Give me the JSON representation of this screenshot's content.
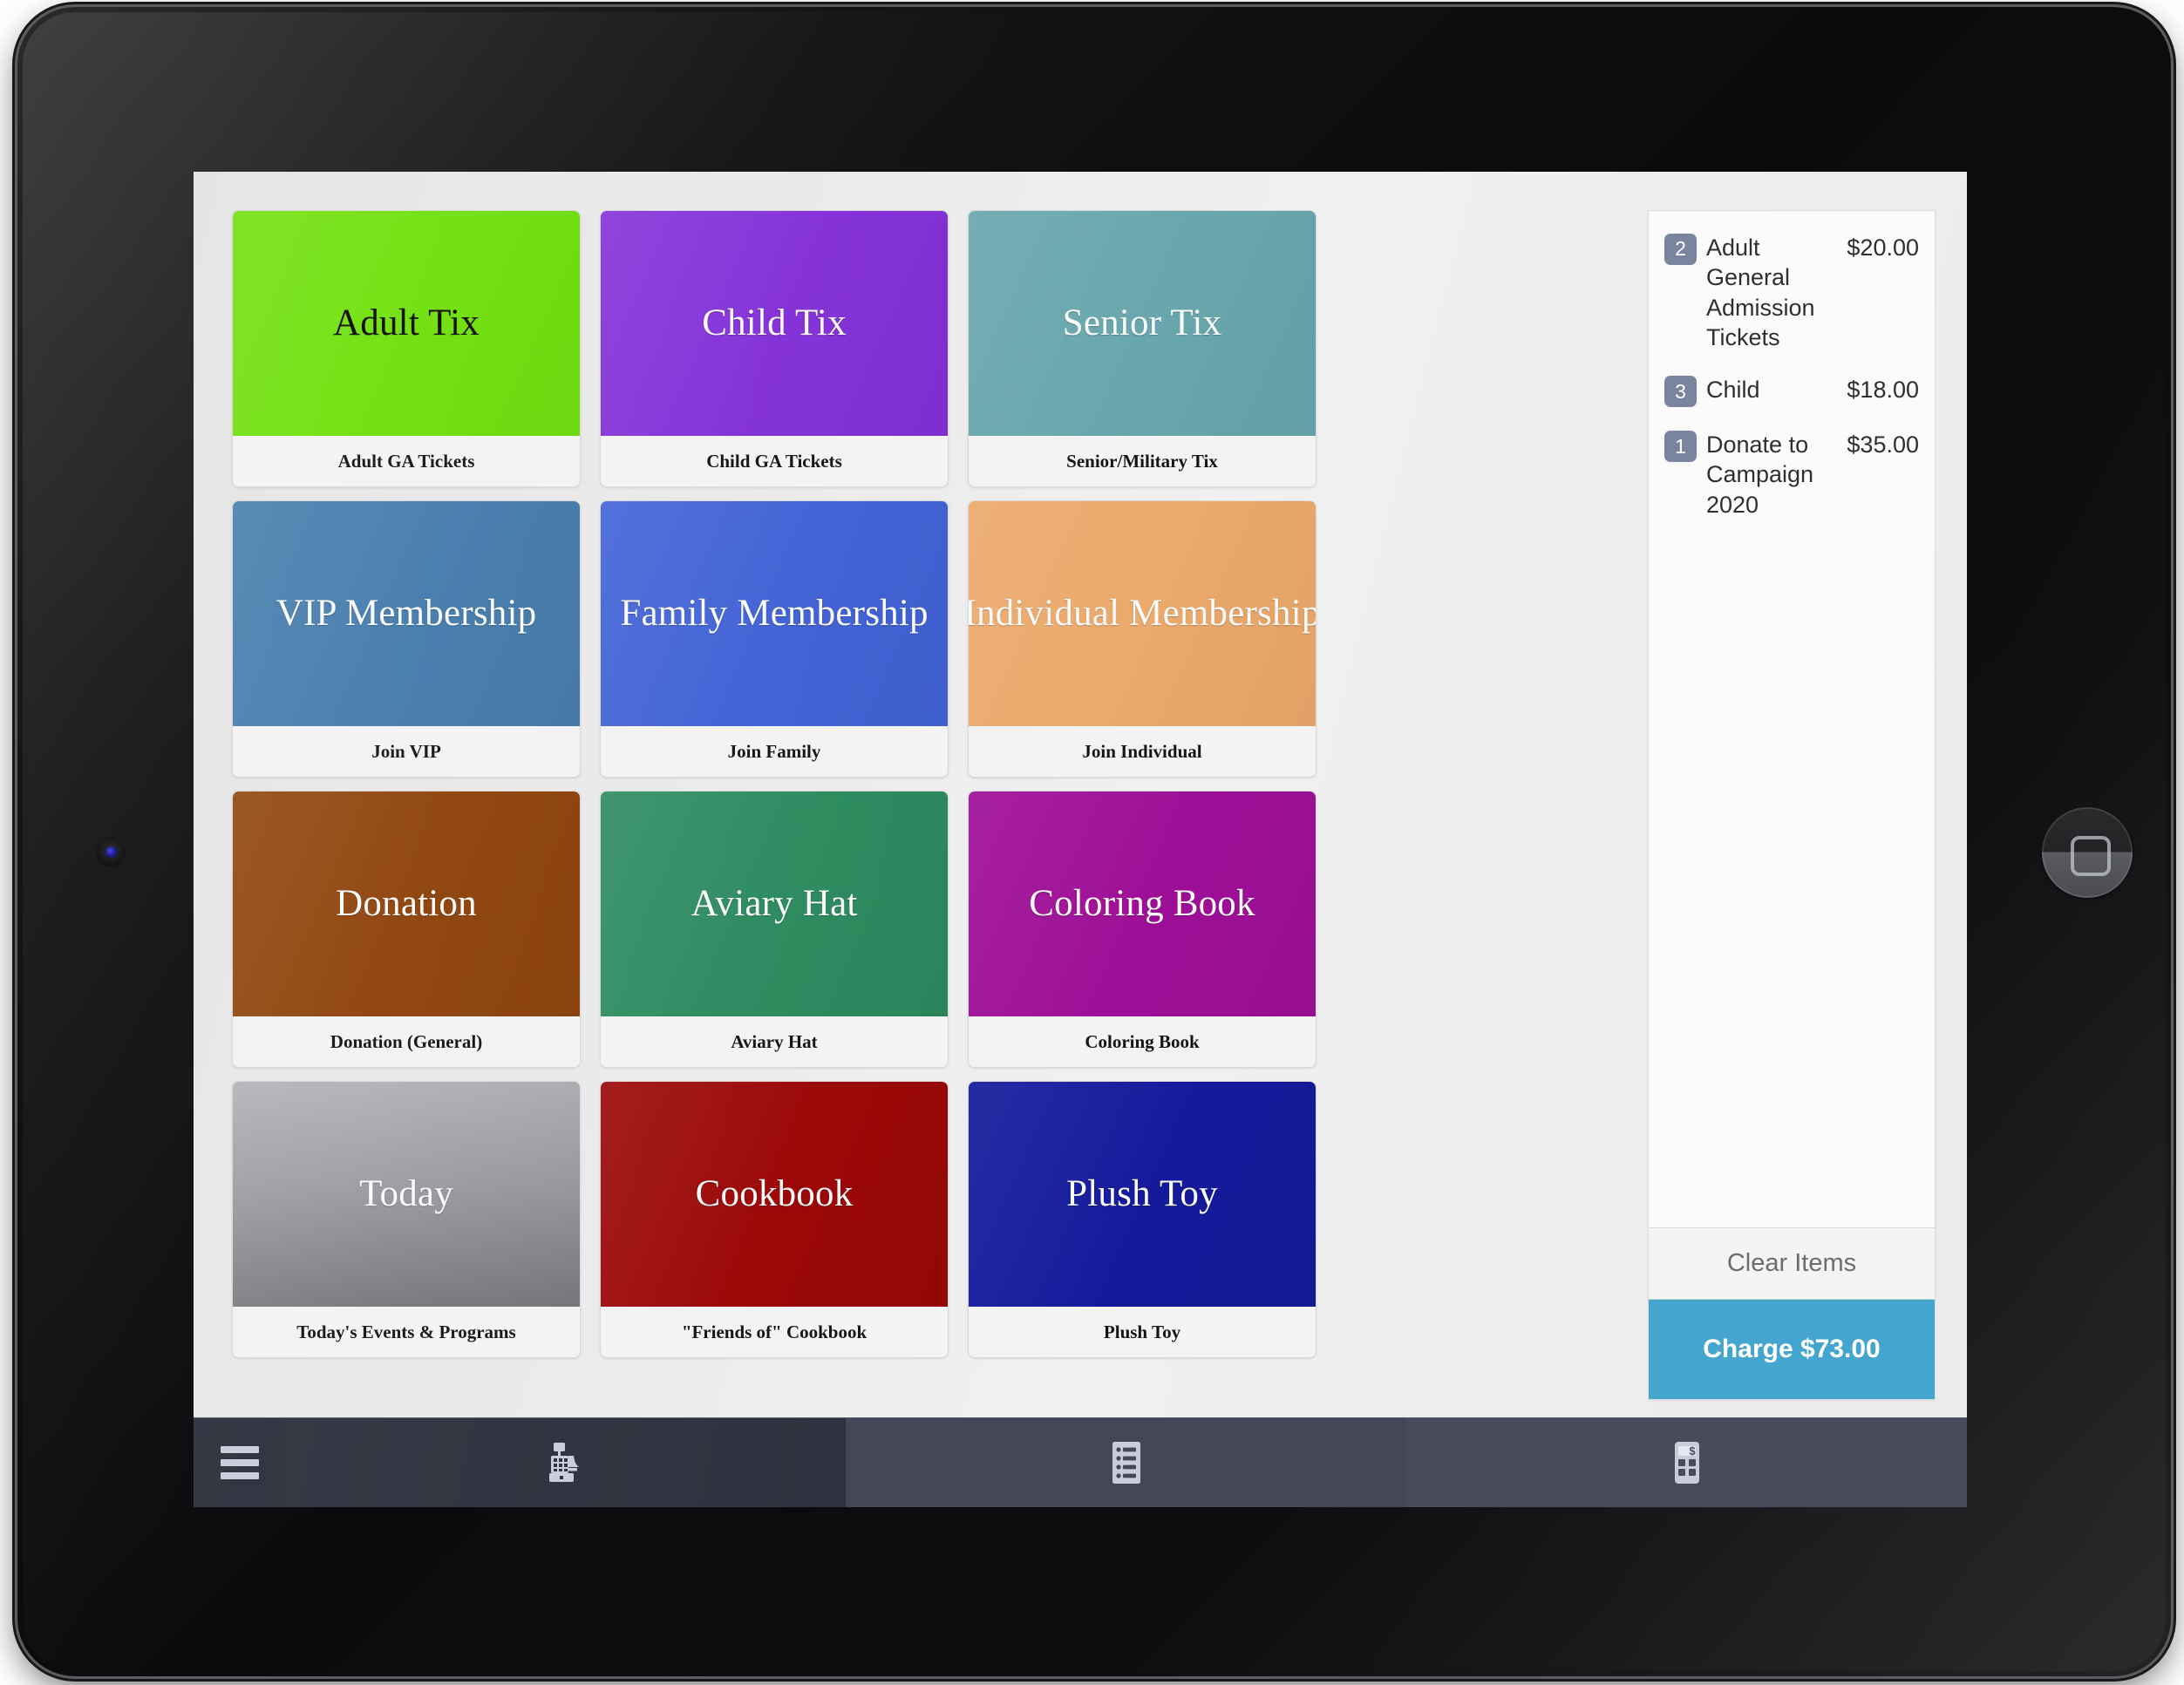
{
  "device": {
    "type": "tablet",
    "camera_icon": "front-camera",
    "home_button_icon": "home-button"
  },
  "grid": {
    "tiles": [
      {
        "title": "Adult Tix",
        "caption": "Adult GA Tickets",
        "color": "#6FE00A",
        "text": "dark"
      },
      {
        "title": "Child Tix",
        "caption": "Child GA Tickets",
        "color": "#8330D8",
        "text": "light"
      },
      {
        "title": "Senior Tix",
        "caption": "Senior/Military Tix",
        "color": "#68A7AD",
        "text": "light"
      },
      {
        "title": "VIP Membership",
        "caption": "Join VIP",
        "color": "#447BAC",
        "text": "light"
      },
      {
        "title": "Family Membership",
        "caption": "Join Family",
        "color": "#4162D6",
        "text": "light"
      },
      {
        "title": "Individual Membership",
        "caption": "Join Individual",
        "color": "#EBA96B",
        "text": "light"
      },
      {
        "title": "Donation",
        "caption": "Donation (General)",
        "color": "#8E4209",
        "text": "light"
      },
      {
        "title": "Aviary Hat",
        "caption": "Aviary Hat",
        "color": "#2C8B5E",
        "text": "light"
      },
      {
        "title": "Coloring Book",
        "caption": "Coloring Book",
        "color": "#9E0F97",
        "text": "light"
      },
      {
        "title": "Today",
        "caption": "Today's Events & Programs",
        "color": "#9A9CA1",
        "text": "light"
      },
      {
        "title": "Cookbook",
        "caption": "\"Friends of\" Cookbook",
        "color": "#9B0707",
        "text": "light"
      },
      {
        "title": "Plush Toy",
        "caption": "Plush Toy",
        "color": "#141A9B",
        "text": "light"
      }
    ]
  },
  "cart": {
    "items": [
      {
        "qty": "2",
        "name": "Adult General Admission Tickets",
        "price": "$20.00"
      },
      {
        "qty": "3",
        "name": "Child",
        "price": "$18.00"
      },
      {
        "qty": "1",
        "name": "Donate to Campaign 2020",
        "price": "$35.00"
      }
    ],
    "clear_label": "Clear Items",
    "charge_label": "Charge $73.00",
    "charge_color": "#44A6CE",
    "badge_color": "#7B849F"
  },
  "toolbar": {
    "items": [
      {
        "icon": "hamburger-menu-icon",
        "name": "menu"
      },
      {
        "icon": "cash-register-icon",
        "name": "register"
      },
      {
        "icon": "list-icon",
        "name": "transactions"
      },
      {
        "icon": "calculator-icon",
        "name": "keypad"
      }
    ]
  }
}
